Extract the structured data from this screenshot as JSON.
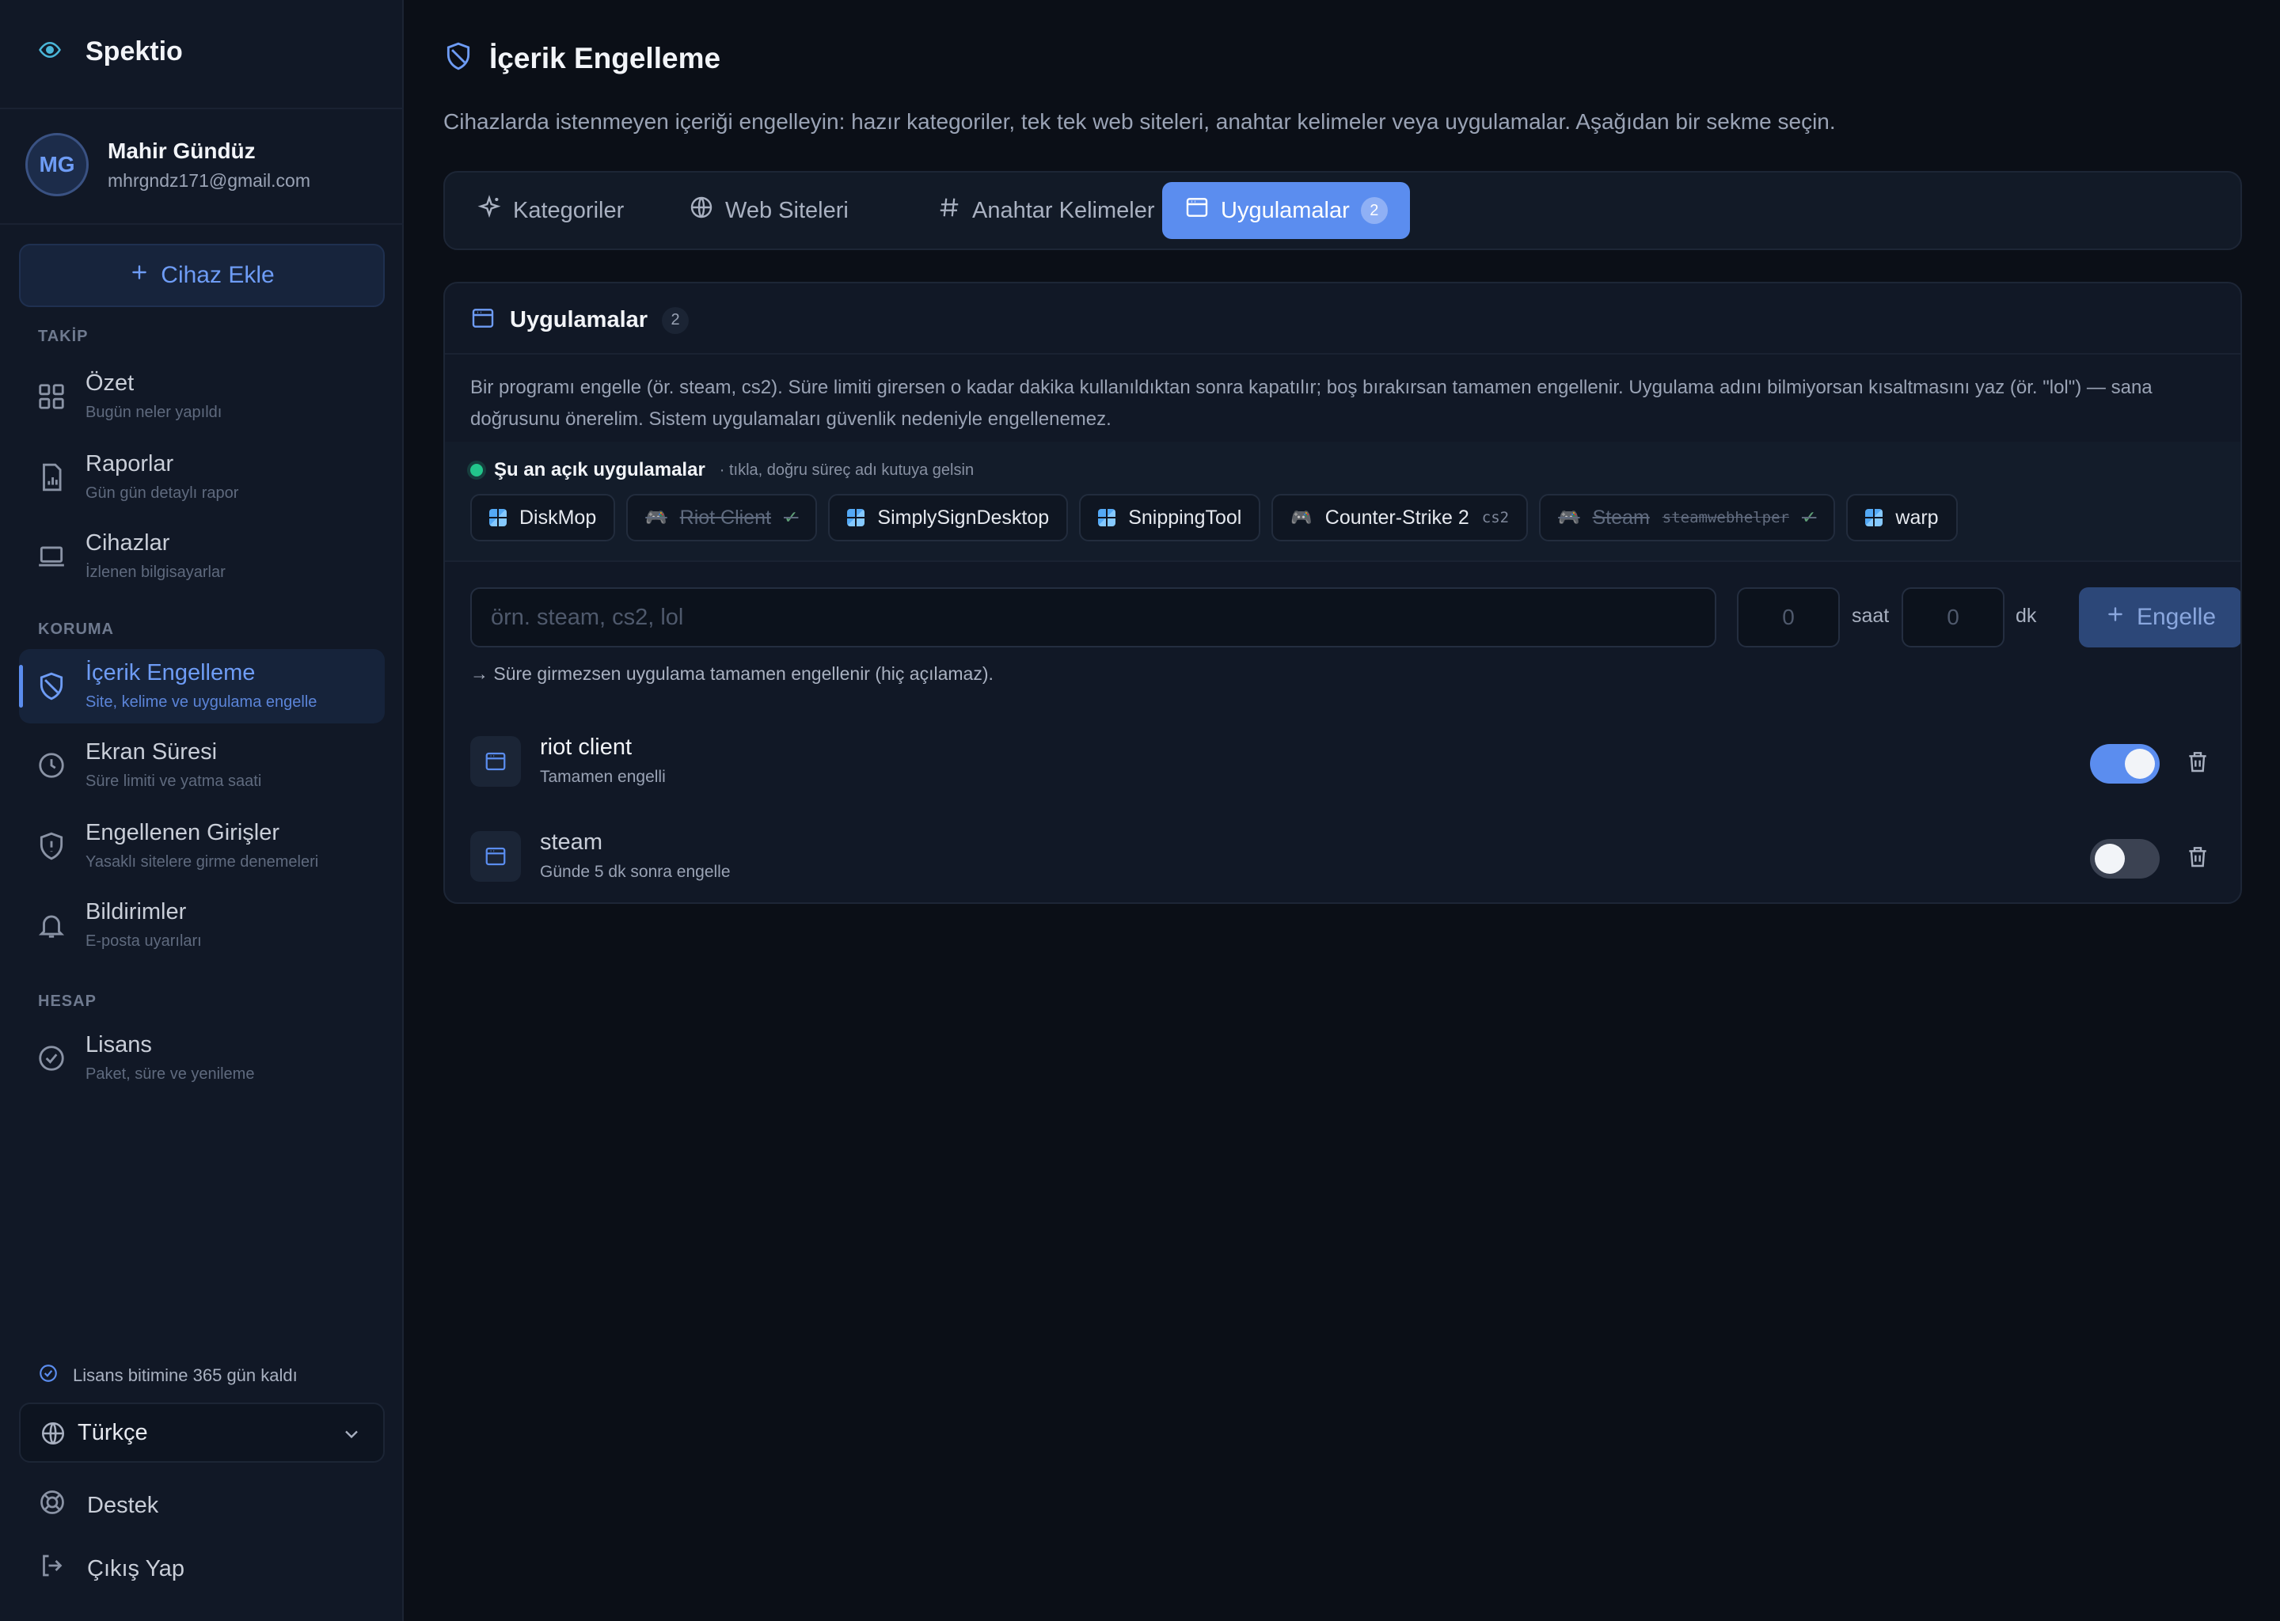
{
  "brand": {
    "name": "Spektio"
  },
  "user": {
    "initials": "MG",
    "name": "Mahir Gündüz",
    "email": "mhrgndz171@gmail.com"
  },
  "sidebar": {
    "add_device": "Cihaz Ekle",
    "sections": {
      "track": "TAKİP",
      "protect": "KORUMA",
      "account": "HESAP"
    },
    "items": [
      {
        "title": "Özet",
        "sub": "Bugün neler yapıldı",
        "icon": "grid-icon"
      },
      {
        "title": "Raporlar",
        "sub": "Gün gün detaylı rapor",
        "icon": "report-icon"
      },
      {
        "title": "Cihazlar",
        "sub": "İzlenen bilgisayarlar",
        "icon": "laptop-icon"
      },
      {
        "title": "İçerik Engelleme",
        "sub": "Site, kelime ve uygulama engelle",
        "icon": "shield-icon",
        "active": true
      },
      {
        "title": "Ekran Süresi",
        "sub": "Süre limiti ve yatma saati",
        "icon": "clock-icon"
      },
      {
        "title": "Engellenen Girişler",
        "sub": "Yasaklı sitelere girme denemeleri",
        "icon": "shield-alert-icon"
      },
      {
        "title": "Bildirimler",
        "sub": "E-posta uyarıları",
        "icon": "bell-icon"
      },
      {
        "title": "Lisans",
        "sub": "Paket, süre ve yenileme",
        "icon": "badge-check-icon"
      }
    ],
    "license_left": "Lisans bitimine 365 gün kaldı",
    "language": "Türkçe",
    "support": "Destek",
    "logout": "Çıkış Yap"
  },
  "page": {
    "title": "İçerik Engelleme",
    "description": "Cihazlarda istenmeyen içeriği engelleyin: hazır kategoriler, tek tek web siteleri, anahtar kelimeler veya uygulamalar. Aşağıdan bir sekme seçin."
  },
  "tabs": [
    {
      "label": "Kategoriler",
      "icon": "sparkle-icon"
    },
    {
      "label": "Web Siteleri",
      "icon": "globe-icon"
    },
    {
      "label": "Anahtar Kelimeler",
      "icon": "hash-icon"
    },
    {
      "label": "Uygulamalar",
      "icon": "app-window-icon",
      "count": "2",
      "active": true
    }
  ],
  "panel": {
    "title": "Uygulamalar",
    "count": "2",
    "description": "Bir programı engelle (ör. steam, cs2). Süre limiti girersen o kadar dakika kullanıldıktan sonra kapatılır; boş bırakırsan tamamen engellenir. Uygulama adını bilmiyorsan kısaltmasını yaz (ör. \"lol\") — sana doğrusunu önerelim. Sistem uygulamaları güvenlik nedeniyle engellenemez.",
    "open_apps": {
      "title": "Şu an açık uygulamalar",
      "hint": "· tıkla, doğru süreç adı kutuya gelsin",
      "chips": [
        {
          "label": "DiskMop",
          "kind": "win"
        },
        {
          "label": "Riot Client",
          "kind": "game",
          "blocked": true,
          "check": "✓"
        },
        {
          "label": "SimplySignDesktop",
          "kind": "win"
        },
        {
          "label": "SnippingTool",
          "kind": "win"
        },
        {
          "label": "Counter-Strike 2",
          "kind": "game",
          "process": "cs2"
        },
        {
          "label": "Steam",
          "kind": "game",
          "blocked": true,
          "process": "steamwebhelper",
          "check": "✓"
        },
        {
          "label": "warp",
          "kind": "win"
        }
      ]
    },
    "form": {
      "name_placeholder": "örn. steam, cs2, lol",
      "hours_placeholder": "0",
      "hours_unit": "saat",
      "minutes_placeholder": "0",
      "minutes_unit": "dk",
      "submit": "Engelle"
    },
    "note": "→ Süre girmezsen uygulama tamamen engellenir (hiç açılamaz).",
    "blocked_apps": [
      {
        "name": "riot client",
        "status": "Tamamen engelli",
        "enabled": true
      },
      {
        "name": "steam",
        "status": "Günde 5 dk sonra engelle",
        "enabled": false
      }
    ]
  },
  "colors": {
    "accent": "#5b8def",
    "background": "#0b0f17",
    "sidebar": "#111826",
    "online": "#22c58b"
  }
}
